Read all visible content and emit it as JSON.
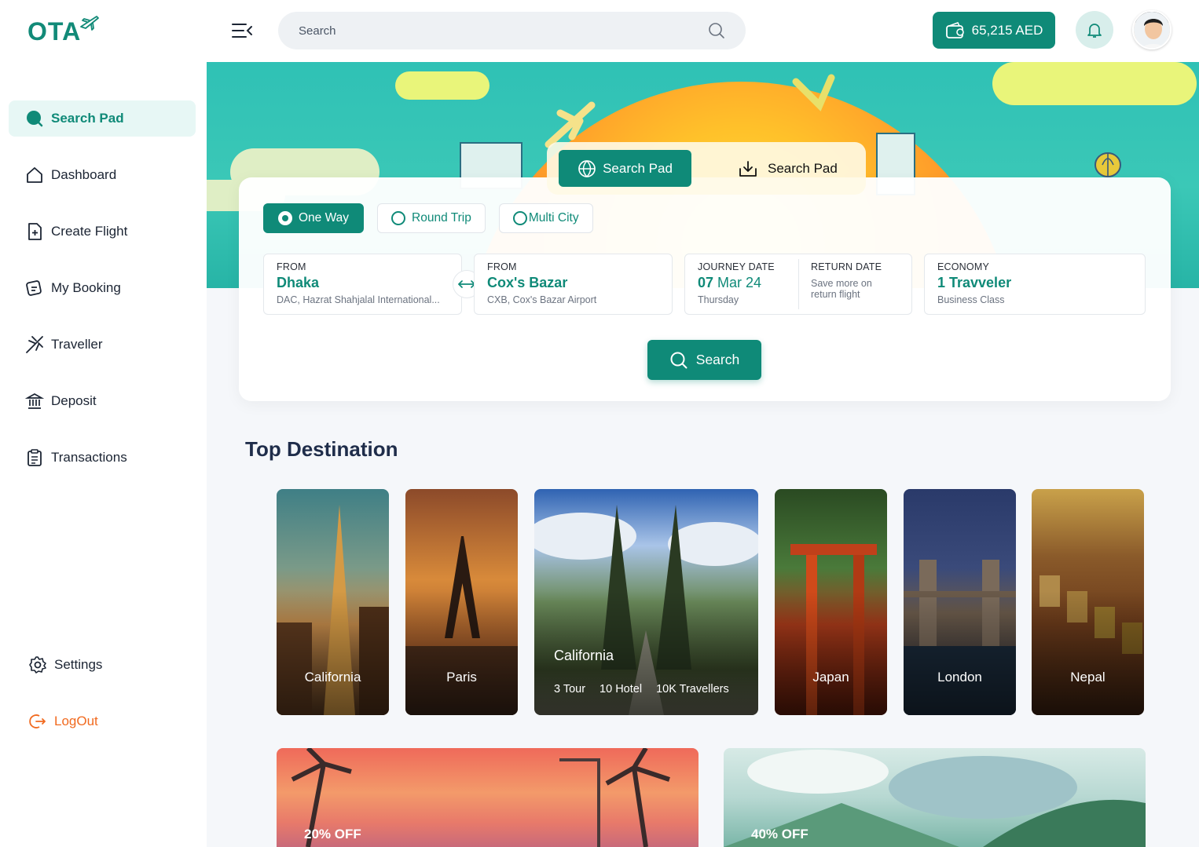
{
  "brand": {
    "name": "OTA"
  },
  "sidebar": {
    "items": [
      {
        "label": "Search Pad",
        "icon": "search-pad-icon"
      },
      {
        "label": "Dashboard",
        "icon": "home-icon"
      },
      {
        "label": "Create Flight",
        "icon": "file-plus-icon"
      },
      {
        "label": "My Booking",
        "icon": "booking-icon"
      },
      {
        "label": "Traveller",
        "icon": "plane-icon"
      },
      {
        "label": "Deposit",
        "icon": "bank-icon"
      },
      {
        "label": "Transactions",
        "icon": "clipboard-icon"
      }
    ],
    "settings": "Settings",
    "logout": "LogOut"
  },
  "topbar": {
    "search_placeholder": "Search",
    "balance": "65,215 AED"
  },
  "search_panel": {
    "tabs": [
      "Search Pad",
      "Search Pad"
    ],
    "trip_types": [
      "One Way",
      "Round Trip",
      "Multi City"
    ],
    "from": {
      "label": "FROM",
      "value": "Dhaka",
      "sub": "DAC, Hazrat Shahjalal International..."
    },
    "to": {
      "label": "FROM",
      "value": "Cox's Bazar",
      "sub": "CXB, Cox's Bazar Airport"
    },
    "journey": {
      "label": "JOURNEY DATE",
      "day": "07",
      "month": "Mar 24",
      "weekday": "Thursday"
    },
    "return": {
      "label": "RETURN DATE",
      "note1": "Save more on",
      "note2": "return flight"
    },
    "class": {
      "label": "ECONOMY",
      "value": "1 Travveler",
      "sub": "Business Class"
    },
    "search_button": "Search"
  },
  "destinations": {
    "title": "Top Destination",
    "items": [
      {
        "name": "California"
      },
      {
        "name": "Paris"
      },
      {
        "name": "California",
        "tours": "3 Tour",
        "hotels": "10 Hotel",
        "travellers": "10K Travellers"
      },
      {
        "name": "Japan"
      },
      {
        "name": "London"
      },
      {
        "name": "Nepal"
      }
    ]
  },
  "promos": [
    {
      "badge": "20% OFF"
    },
    {
      "badge": "40% OFF"
    }
  ],
  "colors": {
    "primary": "#0f8a78",
    "logout": "#f16a1f",
    "title": "#1f2d4a"
  }
}
